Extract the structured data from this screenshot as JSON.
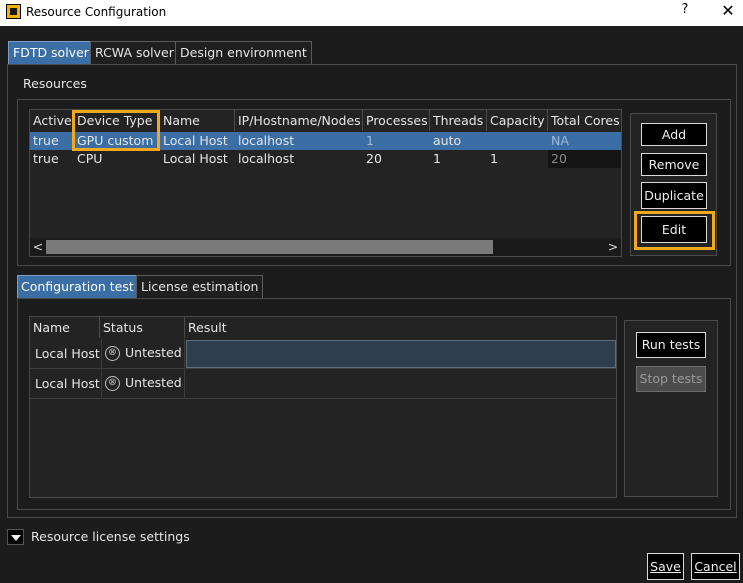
{
  "window": {
    "title": "Resource Configuration",
    "help": "?",
    "close": "✕"
  },
  "main_tabs": [
    "FDTD solver",
    "RCWA solver",
    "Design environment"
  ],
  "resources": {
    "group_label": "Resources",
    "columns": [
      "Active",
      "Device Type",
      "Name",
      "IP/Hostname/Nodes",
      "Processes",
      "Threads",
      "Capacity",
      "Total Cores"
    ],
    "rows": [
      {
        "active": "true",
        "device_type": "GPU custom",
        "name": "Local Host",
        "host": "localhost",
        "processes": "1",
        "threads": "auto",
        "capacity": "",
        "total_cores": "NA"
      },
      {
        "active": "true",
        "device_type": "CPU",
        "name": "Local Host",
        "host": "localhost",
        "processes": "20",
        "threads": "1",
        "capacity": "1",
        "total_cores": "20"
      }
    ],
    "buttons": {
      "add": "Add",
      "remove": "Remove",
      "duplicate": "Duplicate",
      "edit": "Edit"
    },
    "scroll_left": "<",
    "scroll_right": ">"
  },
  "test_tabs": [
    "Configuration test",
    "License estimation"
  ],
  "config_test": {
    "columns": [
      "Name",
      "Status",
      "Result"
    ],
    "rows": [
      {
        "name": "Local Host",
        "status": "Untested",
        "result": ""
      },
      {
        "name": "Local Host",
        "status": "Untested",
        "result": ""
      }
    ],
    "buttons": {
      "run": "Run tests",
      "stop": "Stop tests"
    },
    "status_icon": "⊗"
  },
  "license_settings": "Resource license settings",
  "footer": {
    "save": "Save",
    "cancel": "Cancel"
  },
  "colors": {
    "accent": "#f0a81e",
    "selection": "#3a6ea5",
    "background": "#1c1c1c"
  }
}
